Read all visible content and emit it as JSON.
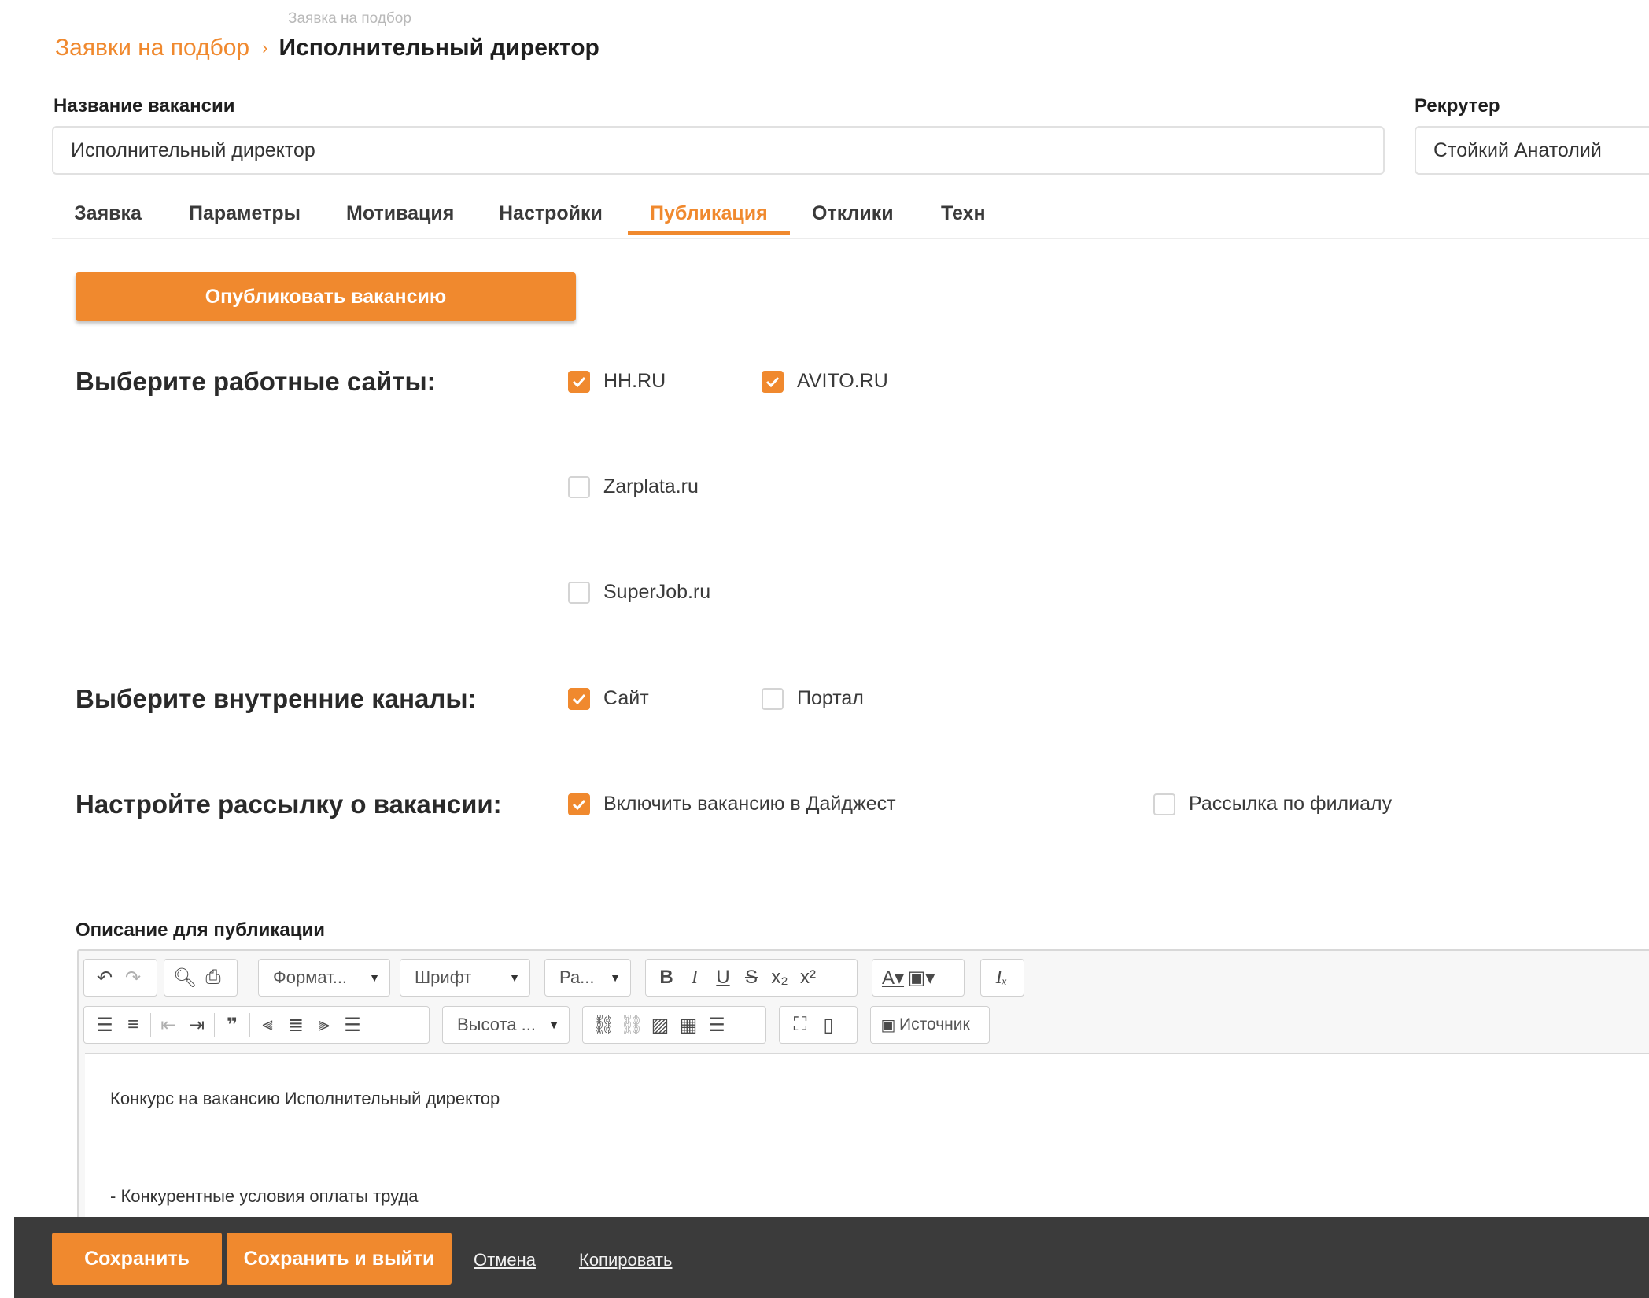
{
  "breadcrumb": {
    "small": "Заявка на подбор",
    "parent": "Заявки на подбор",
    "separator": "›",
    "current": "Исполнительный директор"
  },
  "vacancy_name": {
    "label": "Название вакансии",
    "value": "Исполнительный директор"
  },
  "recruiter": {
    "label": "Рекрутер",
    "value": "Стойкий Анатолий"
  },
  "tabs": [
    {
      "label": "Заявка",
      "active": false
    },
    {
      "label": "Параметры",
      "active": false
    },
    {
      "label": "Мотивация",
      "active": false
    },
    {
      "label": "Настройки",
      "active": false
    },
    {
      "label": "Публикация",
      "active": true
    },
    {
      "label": "Отклики",
      "active": false
    },
    {
      "label": "Техн",
      "active": false
    }
  ],
  "publish_button": "Опубликовать вакансию",
  "job_sites": {
    "title": "Выберите работные сайты:",
    "options": [
      {
        "label": "HH.RU",
        "checked": true
      },
      {
        "label": "AVITO.RU",
        "checked": true
      },
      {
        "label": "Zarplata.ru",
        "checked": false
      },
      {
        "label": "SuperJob.ru",
        "checked": false
      }
    ]
  },
  "internal_channels": {
    "title": "Выберите внутренние каналы:",
    "options": [
      {
        "label": "Сайт",
        "checked": true
      },
      {
        "label": "Портал",
        "checked": false
      }
    ]
  },
  "mailing": {
    "title": "Настройте рассылку о вакансии:",
    "options": [
      {
        "label": "Включить вакансию в Дайджест",
        "checked": true
      },
      {
        "label": "Рассылка по филиалу",
        "checked": false
      }
    ]
  },
  "description": {
    "label": "Описание для публикации",
    "toolbar": {
      "format_select": "Формат...",
      "font_select": "Шрифт",
      "size_select": "Ра...",
      "height_select": "Высота ...",
      "source_button": "Источник"
    },
    "lines": [
      "Конкурс на вакансию Исполнительный директор",
      "- Конкурентные условия оплаты труда"
    ]
  },
  "bottom_bar": {
    "save": "Сохранить",
    "save_exit": "Сохранить и выйти",
    "cancel": "Отмена",
    "copy": "Копировать"
  },
  "colors": {
    "accent": "#f0892e",
    "bottom_bar": "#3b3b3b"
  }
}
